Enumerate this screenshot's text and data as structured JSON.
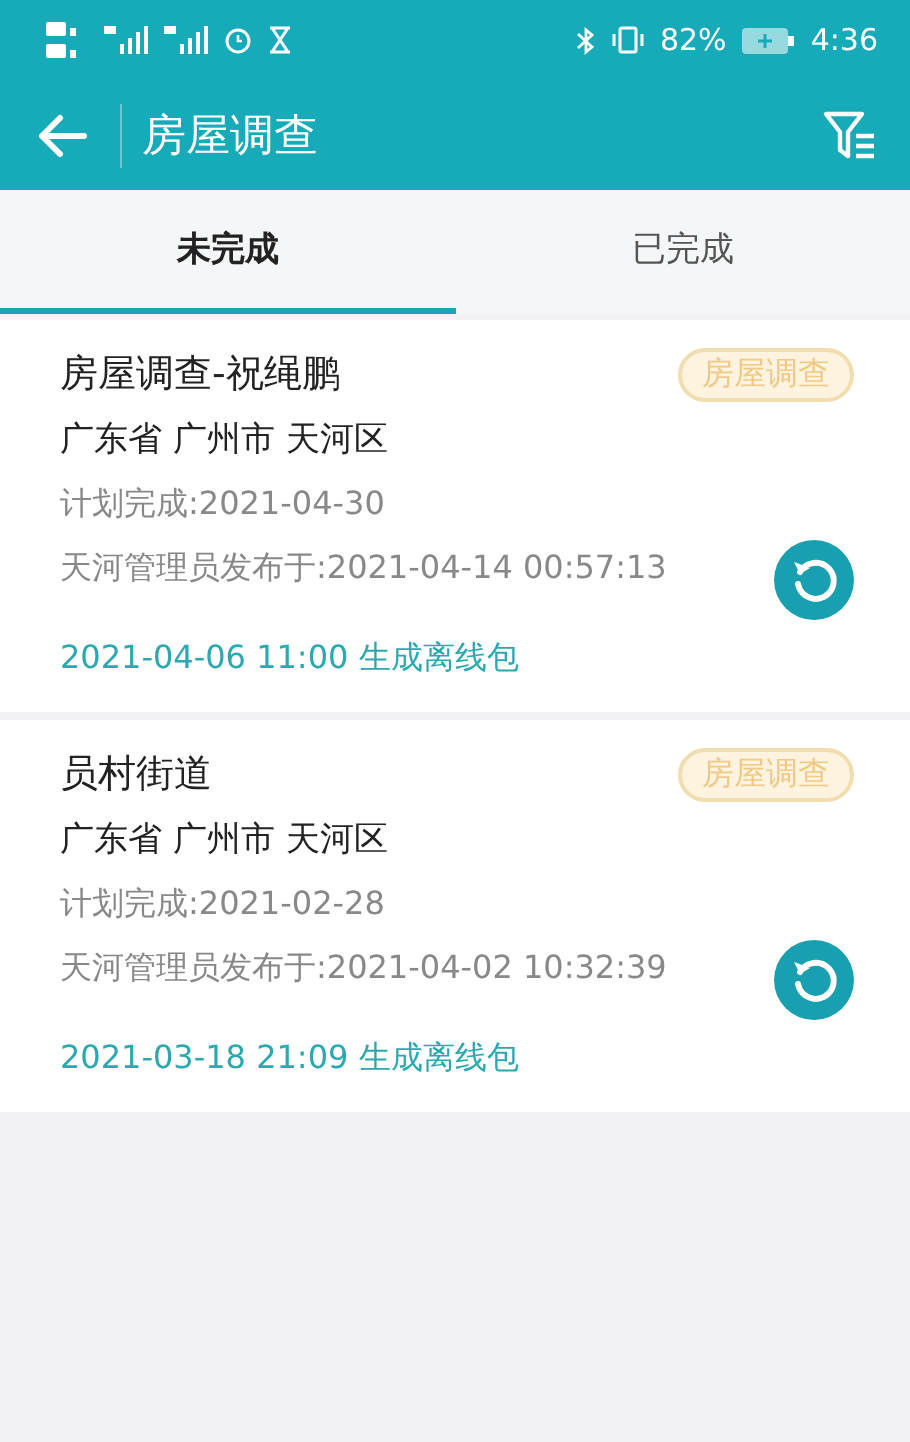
{
  "status_bar": {
    "battery_percent": "82%",
    "time": "4:36"
  },
  "header": {
    "title": "房屋调查"
  },
  "tabs": [
    {
      "label": "未完成",
      "selected": true
    },
    {
      "label": "已完成",
      "selected": false
    }
  ],
  "tasks": [
    {
      "title": "房屋调查-祝绳鹏",
      "tag": "房屋调查",
      "region": "广东省 广州市 天河区",
      "planned": "计划完成:2021-04-30",
      "published": "天河管理员发布于:2021-04-14 00:57:13",
      "offline": "2021-04-06 11:00 生成离线包"
    },
    {
      "title": "员村街道",
      "tag": "房屋调查",
      "region": "广东省 广州市 天河区",
      "planned": "计划完成:2021-02-28",
      "published": "天河管理员发布于:2021-04-02 10:32:39",
      "offline": "2021-03-18 21:09 生成离线包"
    }
  ]
}
